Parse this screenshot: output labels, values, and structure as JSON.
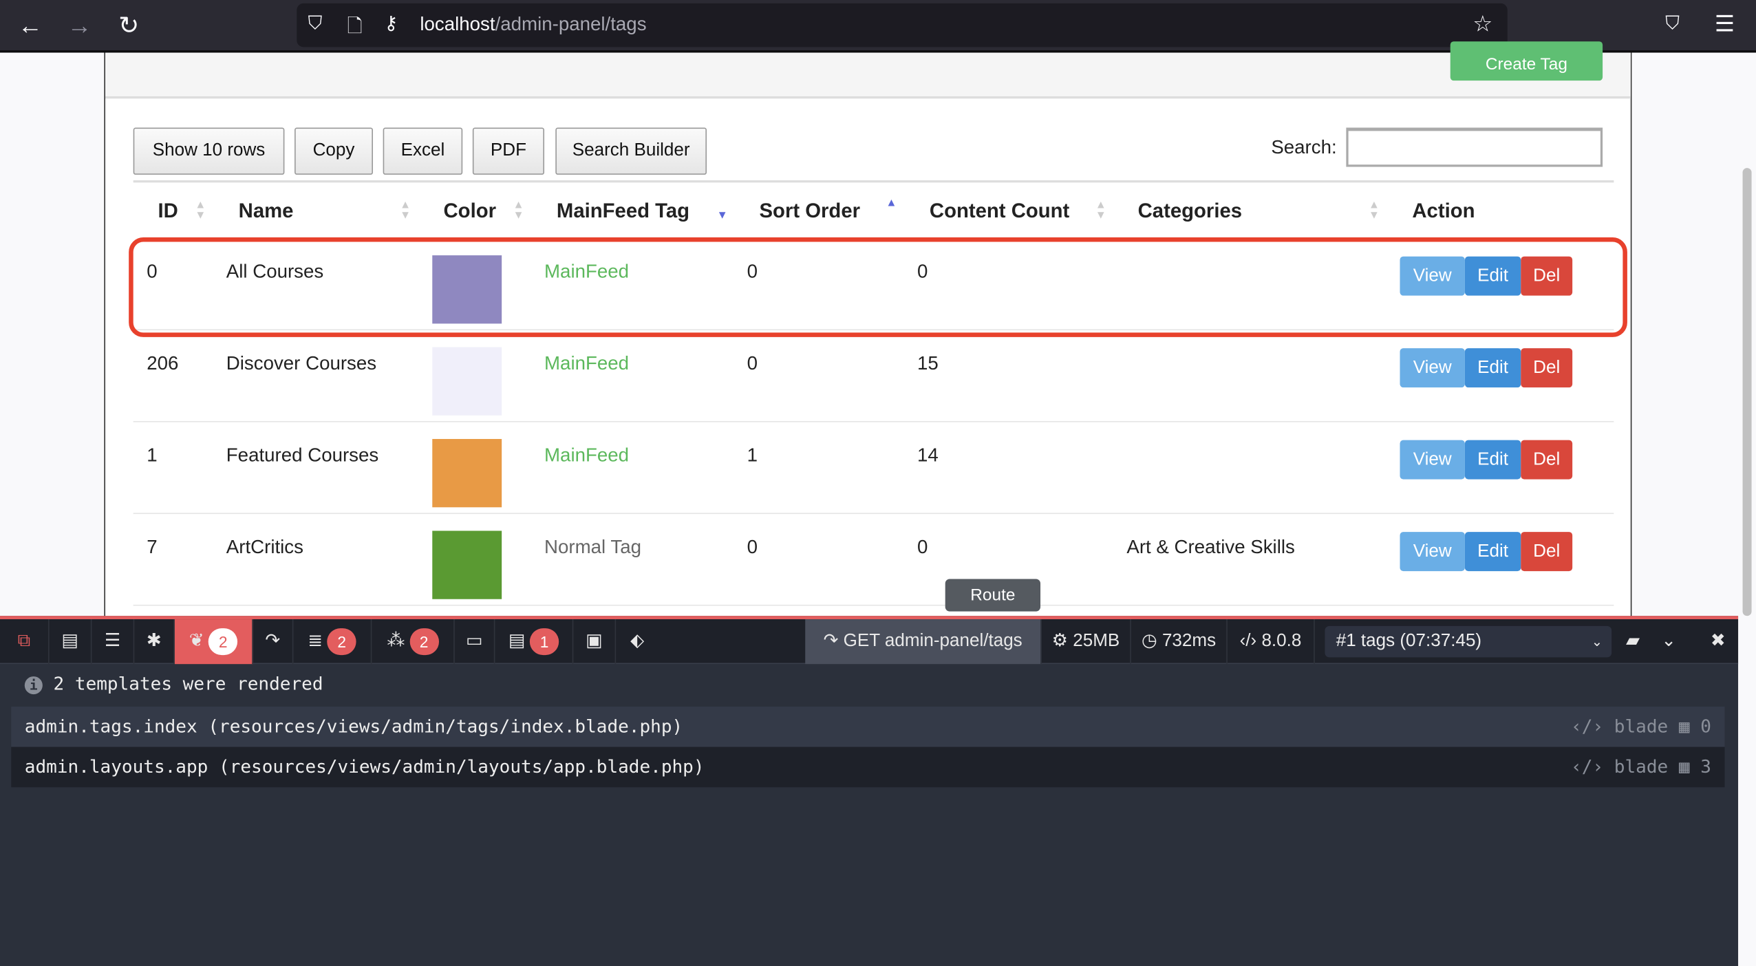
{
  "browser": {
    "url_host": "localhost",
    "url_path": "/admin-panel/tags"
  },
  "header": {
    "create_label": "Create Tag"
  },
  "toolbar": {
    "buttons": [
      "Show 10 rows",
      "Copy",
      "Excel",
      "PDF",
      "Search Builder"
    ],
    "search_label": "Search:",
    "search_value": ""
  },
  "table": {
    "columns": [
      "ID",
      "Name",
      "Color",
      "MainFeed Tag",
      "Sort Order",
      "Content Count",
      "Categories",
      "Action"
    ],
    "sorted_column": "Sort Order",
    "sort_direction": "ascending",
    "rows": [
      {
        "id": "0",
        "name": "All Courses",
        "color": "#8f88c0",
        "feed": "MainFeed",
        "sort": "0",
        "count": "0",
        "categories": ""
      },
      {
        "id": "206",
        "name": "Discover Courses",
        "color": "#f0effa",
        "feed": "MainFeed",
        "sort": "0",
        "count": "15",
        "categories": ""
      },
      {
        "id": "1",
        "name": "Featured Courses",
        "color": "#e89a45",
        "feed": "MainFeed",
        "sort": "1",
        "count": "14",
        "categories": ""
      },
      {
        "id": "7",
        "name": "ArtCritics",
        "color": "#5a9a32",
        "feed": "Normal Tag",
        "sort": "0",
        "count": "0",
        "categories": "Art & Creative Skills"
      }
    ],
    "actions": {
      "view": "View",
      "edit": "Edit",
      "del": "Del"
    }
  },
  "tooltip": "Route",
  "debugbar": {
    "badges": {
      "views": "2",
      "queries": "2",
      "models": "2",
      "messages": "1"
    },
    "request": "GET admin-panel/tags",
    "memory": "25MB",
    "time": "732ms",
    "php": "8.0.8",
    "selected_request": "#1 tags (07:37:45)",
    "summary": "2 templates were rendered",
    "templates": [
      {
        "name": "admin.tags.index (resources/views/admin/tags/index.blade.php)",
        "type": "blade",
        "params": "0"
      },
      {
        "name": "admin.layouts.app (resources/views/admin/layouts/app.blade.php)",
        "type": "blade",
        "params": "3"
      }
    ]
  },
  "colors": {
    "highlight": "#e8412c",
    "mainfeed": "#5cb85c",
    "view": "#6aaee6",
    "edit": "#3f8fd8",
    "del": "#d9473b",
    "debug_accent": "#e35d5e"
  }
}
